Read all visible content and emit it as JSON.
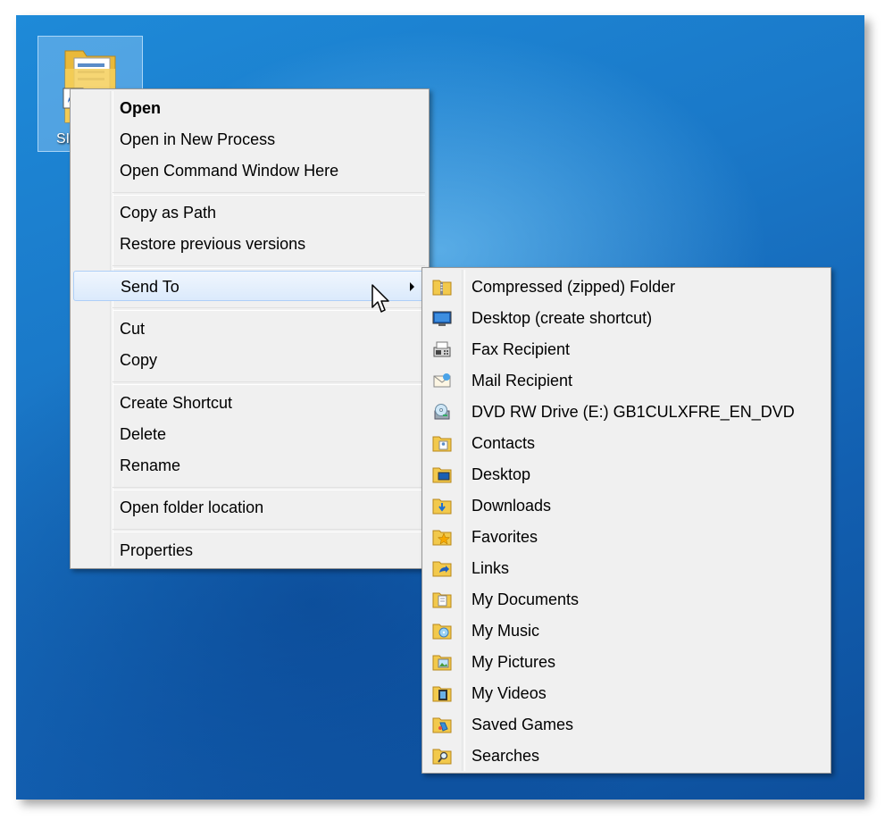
{
  "desktop": {
    "icon_label": "SI"
  },
  "context_menu": {
    "items": [
      {
        "label": "Open"
      },
      {
        "label": "Open in New Process"
      },
      {
        "label": "Open Command Window Here"
      },
      {
        "label": "Copy as Path"
      },
      {
        "label": "Restore previous versions"
      },
      {
        "label": "Send To"
      },
      {
        "label": "Cut"
      },
      {
        "label": "Copy"
      },
      {
        "label": "Create Shortcut"
      },
      {
        "label": "Delete"
      },
      {
        "label": "Rename"
      },
      {
        "label": "Open folder location"
      },
      {
        "label": "Properties"
      }
    ]
  },
  "send_to_menu": {
    "items": [
      {
        "label": "Compressed (zipped) Folder",
        "icon": "zip-folder-icon"
      },
      {
        "label": "Desktop (create shortcut)",
        "icon": "desktop-monitor-icon"
      },
      {
        "label": "Fax Recipient",
        "icon": "fax-icon"
      },
      {
        "label": "Mail Recipient",
        "icon": "mail-icon"
      },
      {
        "label": "DVD RW Drive (E:) GB1CULXFRE_EN_DVD",
        "icon": "dvd-drive-icon"
      },
      {
        "label": "Contacts",
        "icon": "contacts-folder-icon"
      },
      {
        "label": "Desktop",
        "icon": "desktop-folder-icon"
      },
      {
        "label": "Downloads",
        "icon": "downloads-folder-icon"
      },
      {
        "label": "Favorites",
        "icon": "favorites-folder-icon"
      },
      {
        "label": "Links",
        "icon": "links-folder-icon"
      },
      {
        "label": "My Documents",
        "icon": "documents-folder-icon"
      },
      {
        "label": "My Music",
        "icon": "music-folder-icon"
      },
      {
        "label": "My Pictures",
        "icon": "pictures-folder-icon"
      },
      {
        "label": "My Videos",
        "icon": "videos-folder-icon"
      },
      {
        "label": "Saved Games",
        "icon": "saved-games-folder-icon"
      },
      {
        "label": "Searches",
        "icon": "searches-folder-icon"
      }
    ]
  },
  "colors": {
    "desktop_blue": "#1a78c8",
    "menu_bg": "#f0f0f0",
    "hover_border": "#aecff7",
    "folder_yellow": "#f2c94c"
  }
}
